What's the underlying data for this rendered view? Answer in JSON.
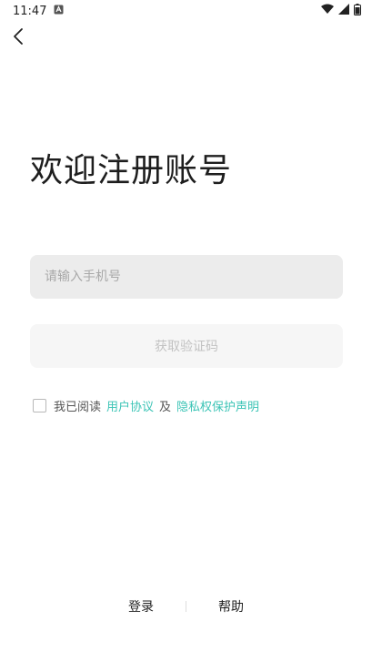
{
  "status_bar": {
    "time": "11:47"
  },
  "title": "欢迎注册账号",
  "phone_input": {
    "placeholder": "请输入手机号",
    "value": ""
  },
  "code_button": {
    "label": "获取验证码"
  },
  "agreement": {
    "prefix": "我已阅读",
    "user_agreement": "用户协议",
    "conjunction": "及",
    "privacy_policy": "隐私权保护声明",
    "checked": false
  },
  "bottom_nav": {
    "login": "登录",
    "help": "帮助"
  },
  "colors": {
    "link": "#3cc4b6",
    "input_bg": "#ececec",
    "button_bg": "#f6f6f6",
    "button_text": "#c2c2c2"
  }
}
